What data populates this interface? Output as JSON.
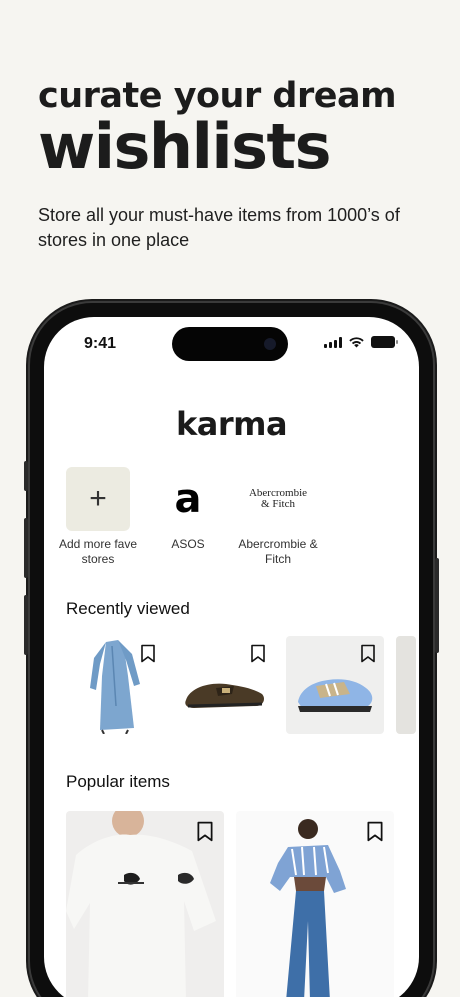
{
  "hero": {
    "title_line1": "curate your dream",
    "title_line2": "wishlists",
    "subtitle": "Store all your must-have items from 1000’s of stores in one place"
  },
  "status_bar": {
    "time": "9:41"
  },
  "app": {
    "logo": "karma"
  },
  "stores": [
    {
      "label": "Add more fave stores",
      "icon": "plus-icon"
    },
    {
      "label": "ASOS",
      "logo_text": "a"
    },
    {
      "label": "Abercrombie & Fitch",
      "logo_text_1": "Abercrombie",
      "logo_text_2": "& Fitch"
    }
  ],
  "sections": {
    "recent": "Recently viewed",
    "popular": "Popular items"
  },
  "recent_items": [
    {
      "name": "blue-shirt-dress",
      "icon": "bookmark-icon"
    },
    {
      "name": "brown-suede-loafer",
      "icon": "bookmark-icon"
    },
    {
      "name": "blue-sneaker",
      "icon": "bookmark-icon"
    }
  ],
  "popular_items": [
    {
      "name": "white-graphic-tee",
      "icon": "bookmark-icon"
    },
    {
      "name": "striped-shirt-jeans-outfit",
      "icon": "bookmark-icon"
    }
  ],
  "colors": {
    "background": "#f6f5f1",
    "add_tile": "#ecebe1",
    "phone_frame": "#0d0d0d"
  }
}
